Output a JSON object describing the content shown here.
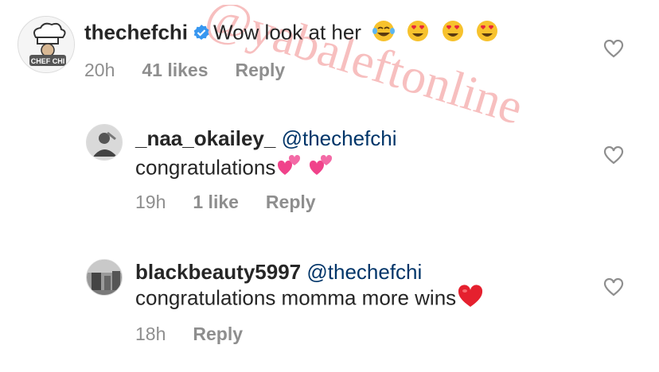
{
  "comments": [
    {
      "username": "thechefchi",
      "verified": true,
      "mention": "",
      "text": "Wow look at her",
      "text_line2": "",
      "emojis": [
        "face-with-tears-of-joy",
        "heart-eyes",
        "heart-eyes",
        "heart-eyes"
      ],
      "time": "20h",
      "likes": "41 likes",
      "reply": "Reply",
      "avatar_text": "CHEF CHI"
    },
    {
      "username": "_naa_okailey_",
      "verified": false,
      "mention": "@thechefchi",
      "text": "congratulations",
      "emojis": [
        "two-hearts",
        "two-hearts"
      ],
      "time": "19h",
      "likes": "1 like",
      "reply": "Reply"
    },
    {
      "username": "blackbeauty5997",
      "verified": false,
      "mention": "@thechefchi",
      "text": "congratulations momma more wins",
      "emojis": [
        "red-heart"
      ],
      "time": "18h",
      "likes": "",
      "reply": "Reply"
    }
  ],
  "watermark": "@yabaleftonline",
  "colors": {
    "username": "#262626",
    "mention": "#003569",
    "meta": "#8e8e8e",
    "verified": "#3897f0",
    "watermark": "#f08a8a"
  }
}
